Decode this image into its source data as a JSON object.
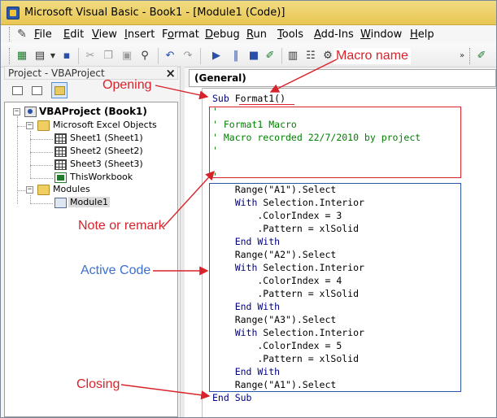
{
  "window": {
    "title": "Microsoft Visual Basic - Book1 - [Module1 (Code)]"
  },
  "menu": [
    {
      "label": "File",
      "accel": "F"
    },
    {
      "label": "Edit",
      "accel": "E"
    },
    {
      "label": "View",
      "accel": "V"
    },
    {
      "label": "Insert",
      "accel": "I"
    },
    {
      "label": "Format",
      "accel": "o"
    },
    {
      "label": "Debug",
      "accel": "D"
    },
    {
      "label": "Run",
      "accel": "R"
    },
    {
      "label": "Tools",
      "accel": "T"
    },
    {
      "label": "Add-Ins",
      "accel": "A"
    },
    {
      "label": "Window",
      "accel": "W"
    },
    {
      "label": "Help",
      "accel": "H"
    }
  ],
  "project_pane": {
    "title": "Project - VBAProject",
    "close": "×",
    "tree": {
      "root": "VBAProject (Book1)",
      "excel_objects": "Microsoft Excel Objects",
      "sheets": [
        "Sheet1 (Sheet1)",
        "Sheet2 (Sheet2)",
        "Sheet3 (Sheet3)"
      ],
      "workbook": "ThisWorkbook",
      "modules": "Modules",
      "module1": "Module1"
    }
  },
  "code_pane": {
    "object_combo": "(General)",
    "lines": [
      "Sub Format1()",
      "'",
      "' Format1 Macro",
      "' Macro recorded 22/7/2010 by project",
      "'",
      "",
      "'",
      "    Range(\"A1\").Select",
      "    With Selection.Interior",
      "        .ColorIndex = 3",
      "        .Pattern = xlSolid",
      "    End With",
      "    Range(\"A2\").Select",
      "    With Selection.Interior",
      "        .ColorIndex = 4",
      "        .Pattern = xlSolid",
      "    End With",
      "    Range(\"A3\").Select",
      "    With Selection.Interior",
      "        .ColorIndex = 5",
      "        .Pattern = xlSolid",
      "    End With",
      "    Range(\"A1\").Select",
      "End Sub"
    ]
  },
  "annotations": {
    "macro_name": "Macro name",
    "opening": "Opening",
    "note": "Note or remark",
    "active": "Active Code",
    "closing": "Closing"
  },
  "colors": {
    "annotation_red": "#d8232a",
    "annotation_blue": "#3c6fd0",
    "vba_keyword": "#00007f",
    "vba_comment": "#008000"
  }
}
